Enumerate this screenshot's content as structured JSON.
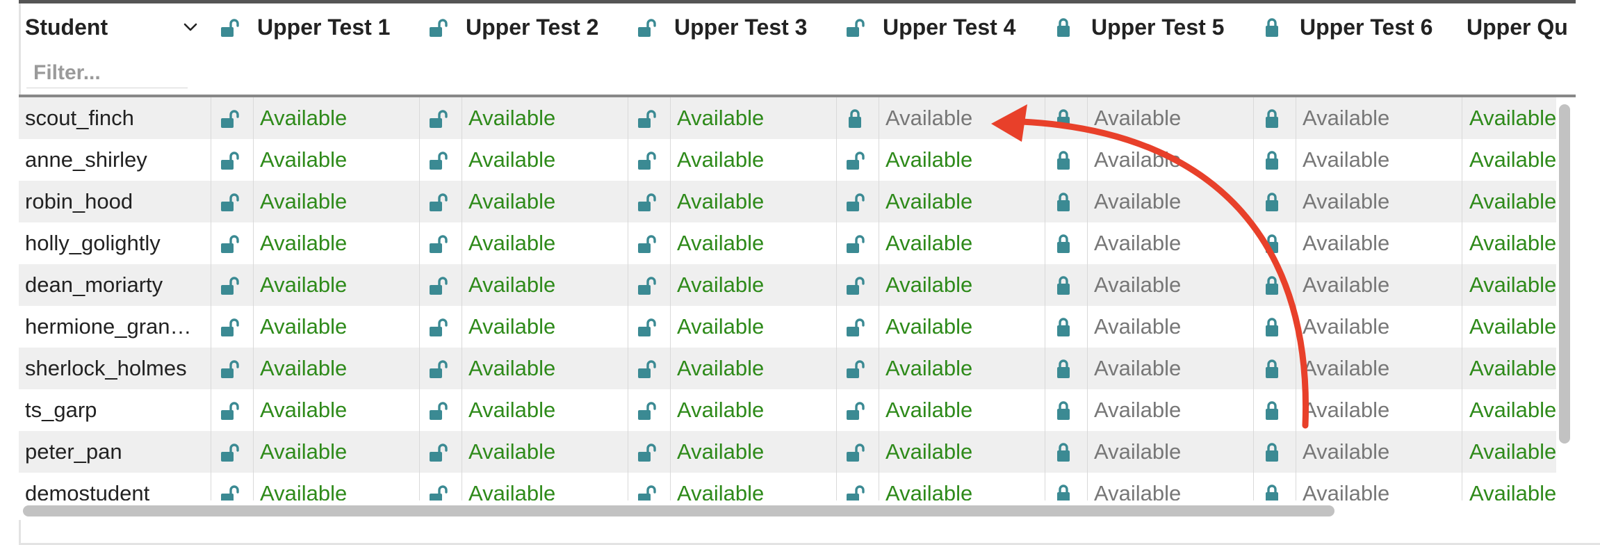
{
  "colors": {
    "lock": "#3b8a93",
    "available": "#2e8a1a",
    "unavailable": "#777777",
    "arrow": "#e8402a"
  },
  "header": {
    "student_label": "Student",
    "filter_placeholder": "Filter...",
    "columns": [
      {
        "title": "Upper Test 1",
        "locked": false
      },
      {
        "title": "Upper Test 2",
        "locked": false
      },
      {
        "title": "Upper Test 3",
        "locked": false
      },
      {
        "title": "Upper Test 4",
        "locked": false
      },
      {
        "title": "Upper Test 5",
        "locked": true
      },
      {
        "title": "Upper Test 6",
        "locked": true
      },
      {
        "title": "Upper Qu",
        "locked": null
      }
    ]
  },
  "rows": [
    {
      "student": "scout_finch",
      "cells": [
        {
          "locked": false,
          "status": "Available",
          "active": true
        },
        {
          "locked": false,
          "status": "Available",
          "active": true
        },
        {
          "locked": false,
          "status": "Available",
          "active": true
        },
        {
          "locked": true,
          "status": "Available",
          "active": false
        },
        {
          "locked": true,
          "status": "Available",
          "active": false
        },
        {
          "locked": true,
          "status": "Available",
          "active": false
        },
        {
          "locked": null,
          "status": "Available",
          "active": true
        }
      ]
    },
    {
      "student": "anne_shirley",
      "cells": [
        {
          "locked": false,
          "status": "Available",
          "active": true
        },
        {
          "locked": false,
          "status": "Available",
          "active": true
        },
        {
          "locked": false,
          "status": "Available",
          "active": true
        },
        {
          "locked": false,
          "status": "Available",
          "active": true
        },
        {
          "locked": true,
          "status": "Available",
          "active": false
        },
        {
          "locked": true,
          "status": "Available",
          "active": false
        },
        {
          "locked": null,
          "status": "Available",
          "active": true
        }
      ]
    },
    {
      "student": "robin_hood",
      "cells": [
        {
          "locked": false,
          "status": "Available",
          "active": true
        },
        {
          "locked": false,
          "status": "Available",
          "active": true
        },
        {
          "locked": false,
          "status": "Available",
          "active": true
        },
        {
          "locked": false,
          "status": "Available",
          "active": true
        },
        {
          "locked": true,
          "status": "Available",
          "active": false
        },
        {
          "locked": true,
          "status": "Available",
          "active": false
        },
        {
          "locked": null,
          "status": "Available",
          "active": true
        }
      ]
    },
    {
      "student": "holly_golightly",
      "cells": [
        {
          "locked": false,
          "status": "Available",
          "active": true
        },
        {
          "locked": false,
          "status": "Available",
          "active": true
        },
        {
          "locked": false,
          "status": "Available",
          "active": true
        },
        {
          "locked": false,
          "status": "Available",
          "active": true
        },
        {
          "locked": true,
          "status": "Available",
          "active": false
        },
        {
          "locked": true,
          "status": "Available",
          "active": false
        },
        {
          "locked": null,
          "status": "Available",
          "active": true
        }
      ]
    },
    {
      "student": "dean_moriarty",
      "cells": [
        {
          "locked": false,
          "status": "Available",
          "active": true
        },
        {
          "locked": false,
          "status": "Available",
          "active": true
        },
        {
          "locked": false,
          "status": "Available",
          "active": true
        },
        {
          "locked": false,
          "status": "Available",
          "active": true
        },
        {
          "locked": true,
          "status": "Available",
          "active": false
        },
        {
          "locked": true,
          "status": "Available",
          "active": false
        },
        {
          "locked": null,
          "status": "Available",
          "active": true
        }
      ]
    },
    {
      "student": "hermione_gran…",
      "cells": [
        {
          "locked": false,
          "status": "Available",
          "active": true
        },
        {
          "locked": false,
          "status": "Available",
          "active": true
        },
        {
          "locked": false,
          "status": "Available",
          "active": true
        },
        {
          "locked": false,
          "status": "Available",
          "active": true
        },
        {
          "locked": true,
          "status": "Available",
          "active": false
        },
        {
          "locked": true,
          "status": "Available",
          "active": false
        },
        {
          "locked": null,
          "status": "Available",
          "active": true
        }
      ]
    },
    {
      "student": "sherlock_holmes",
      "cells": [
        {
          "locked": false,
          "status": "Available",
          "active": true
        },
        {
          "locked": false,
          "status": "Available",
          "active": true
        },
        {
          "locked": false,
          "status": "Available",
          "active": true
        },
        {
          "locked": false,
          "status": "Available",
          "active": true
        },
        {
          "locked": true,
          "status": "Available",
          "active": false
        },
        {
          "locked": true,
          "status": "Available",
          "active": false
        },
        {
          "locked": null,
          "status": "Available",
          "active": true
        }
      ]
    },
    {
      "student": "ts_garp",
      "cells": [
        {
          "locked": false,
          "status": "Available",
          "active": true
        },
        {
          "locked": false,
          "status": "Available",
          "active": true
        },
        {
          "locked": false,
          "status": "Available",
          "active": true
        },
        {
          "locked": false,
          "status": "Available",
          "active": true
        },
        {
          "locked": true,
          "status": "Available",
          "active": false
        },
        {
          "locked": true,
          "status": "Available",
          "active": false
        },
        {
          "locked": null,
          "status": "Available",
          "active": true
        }
      ]
    },
    {
      "student": "peter_pan",
      "cells": [
        {
          "locked": false,
          "status": "Available",
          "active": true
        },
        {
          "locked": false,
          "status": "Available",
          "active": true
        },
        {
          "locked": false,
          "status": "Available",
          "active": true
        },
        {
          "locked": false,
          "status": "Available",
          "active": true
        },
        {
          "locked": true,
          "status": "Available",
          "active": false
        },
        {
          "locked": true,
          "status": "Available",
          "active": false
        },
        {
          "locked": null,
          "status": "Available",
          "active": true
        }
      ]
    },
    {
      "student": "demostudent",
      "cells": [
        {
          "locked": false,
          "status": "Available",
          "active": true
        },
        {
          "locked": false,
          "status": "Available",
          "active": true
        },
        {
          "locked": false,
          "status": "Available",
          "active": true
        },
        {
          "locked": false,
          "status": "Available",
          "active": true
        },
        {
          "locked": true,
          "status": "Available",
          "active": false
        },
        {
          "locked": true,
          "status": "Available",
          "active": false
        },
        {
          "locked": null,
          "status": "Available",
          "active": true
        }
      ]
    }
  ]
}
